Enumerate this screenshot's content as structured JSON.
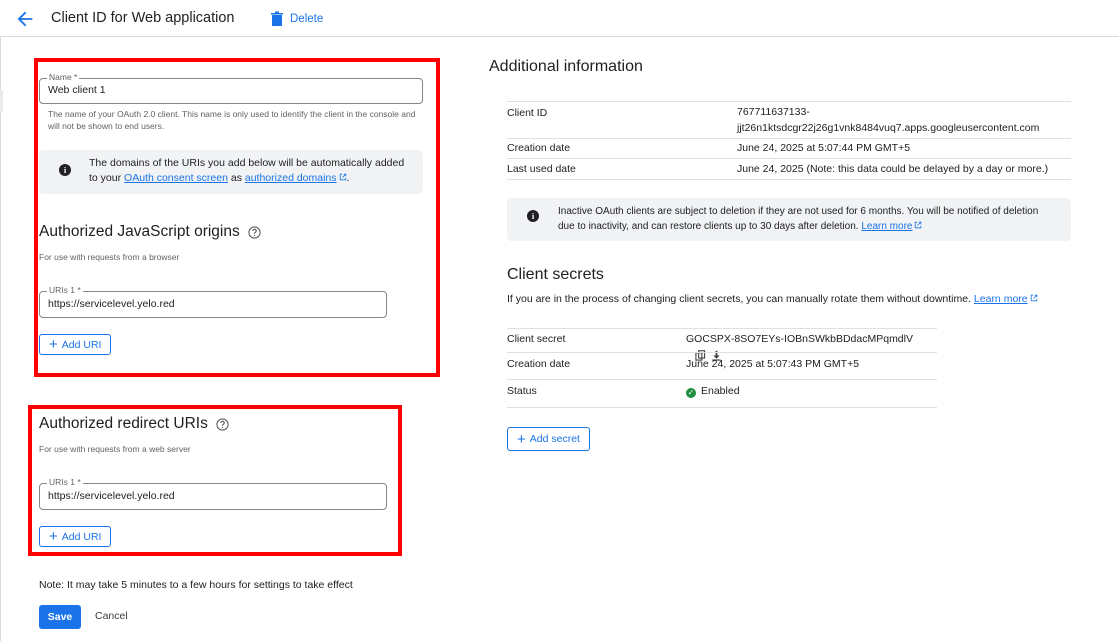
{
  "header": {
    "title": "Client ID for Web application",
    "delete_label": "Delete"
  },
  "form": {
    "name_field": {
      "label": "Name *",
      "value": "Web client 1",
      "helper": "The name of your OAuth 2.0 client. This name is only used to identify the client in the console and will not be shown to end users."
    },
    "domains_note": {
      "text_before": "The domains of the URIs you add below will be automatically added to your ",
      "link1": "OAuth consent screen",
      "text_middle": " as ",
      "link2": "authorized domains",
      "text_after": "."
    },
    "js_origins": {
      "title": "Authorized JavaScript origins",
      "subtitle": "For use with requests from a browser",
      "uri_label": "URIs 1 *",
      "uri_value": "https://servicelevel.yelo.red",
      "add_label": "Add URI"
    },
    "redirect_uris": {
      "title": "Authorized redirect URIs",
      "subtitle": "For use with requests from a web server",
      "uri_label": "URIs 1 *",
      "uri_value": "https://servicelevel.yelo.red",
      "add_label": "Add URI"
    },
    "note": "Note: It may take 5 minutes to a few hours for settings to take effect",
    "save_label": "Save",
    "cancel_label": "Cancel"
  },
  "additional_info": {
    "title": "Additional information",
    "rows": [
      {
        "key": "Client ID",
        "value_line1": "767711637133-",
        "value_line2": "jjt26n1ktsdcgr22j26g1vnk8484vuq7.apps.googleusercontent.com"
      },
      {
        "key": "Creation date",
        "value": "June 24, 2025 at 5:07:44 PM GMT+5"
      },
      {
        "key": "Last used date",
        "value": "June 24, 2025 (Note: this data could be delayed by a day or more.)"
      }
    ],
    "inactive_note": {
      "text": "Inactive OAuth clients are subject to deletion if they are not used for 6 months. You will be notified of deletion due to inactivity, and can restore clients up to 30 days after deletion. ",
      "link": "Learn more"
    }
  },
  "client_secrets": {
    "title": "Client secrets",
    "description": "If you are in the process of changing client secrets, you can manually rotate them without downtime. ",
    "link": "Learn more",
    "rows": [
      {
        "key": "Client secret",
        "value": "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"
      },
      {
        "key": "Creation date",
        "value": "June 24, 2025 at 5:07:43 PM GMT+5"
      },
      {
        "key": "Status",
        "value": "Enabled"
      }
    ],
    "add_label": "Add secret"
  },
  "colors": {
    "accent": "#1a73e8",
    "highlight": "#ff0000",
    "enabled": "#1e8e3e"
  },
  "icons": [
    "back-arrow-icon",
    "trash-icon",
    "info-icon",
    "help-icon",
    "external-link-icon",
    "copy-icon",
    "download-icon",
    "check-circle-icon",
    "plus-icon"
  ]
}
